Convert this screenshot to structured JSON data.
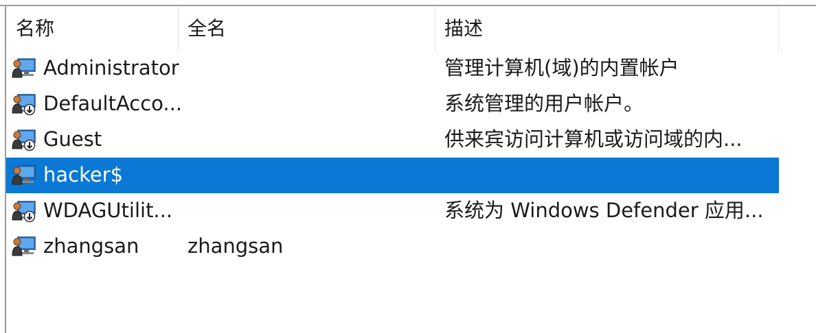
{
  "columns": {
    "name": "名称",
    "fullname": "全名",
    "description": "描述"
  },
  "users": [
    {
      "name": "Administrator",
      "fullname": "",
      "description": "管理计算机(域)的内置帐户",
      "icon": "user-account-icon",
      "disabled": false,
      "selected": false
    },
    {
      "name": "DefaultAcco...",
      "fullname": "",
      "description": "系统管理的用户帐户。",
      "icon": "disabled-user-account-icon",
      "disabled": true,
      "selected": false
    },
    {
      "name": "Guest",
      "fullname": "",
      "description": "供来宾访问计算机或访问域的内...",
      "icon": "disabled-user-account-icon",
      "disabled": true,
      "selected": false
    },
    {
      "name": "hacker$",
      "fullname": "",
      "description": "",
      "icon": "user-account-icon",
      "disabled": false,
      "selected": true
    },
    {
      "name": "WDAGUtilit...",
      "fullname": "",
      "description": "系统为 Windows Defender 应用...",
      "icon": "disabled-user-account-icon",
      "disabled": true,
      "selected": false
    },
    {
      "name": "zhangsan",
      "fullname": "zhangsan",
      "description": "",
      "icon": "user-account-icon",
      "disabled": false,
      "selected": false
    }
  ],
  "colors": {
    "selection": "#0a78d4",
    "text": "#1a1a1a"
  }
}
